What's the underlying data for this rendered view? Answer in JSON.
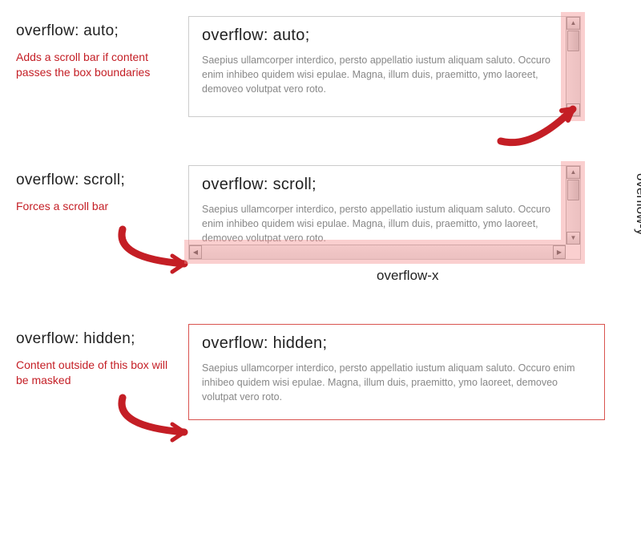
{
  "sections": [
    {
      "left_title": "overflow: auto;",
      "left_desc": "Adds a scroll bar if content passes the box boundaries",
      "demo_title": "overflow: auto;",
      "demo_text": "Saepius ullamcorper interdico, persto appellatio iustum aliquam saluto. Occuro enim inhibeo quidem wisi epulae. Magna, illum duis, praemitto, ymo laoreet, demoveo volutpat vero roto."
    },
    {
      "left_title": "overflow: scroll;",
      "left_desc": "Forces a scroll bar",
      "demo_title": "overflow: scroll;",
      "demo_text": "Saepius ullamcorper interdico, persto appellatio iustum aliquam saluto. Occuro enim inhibeo quidem wisi epulae. Magna, illum duis, praemitto, ymo laoreet, demoveo volutpat vero roto.",
      "axis_x": "overflow-x",
      "axis_y": "overflow-y"
    },
    {
      "left_title": "overflow: hidden;",
      "left_desc": "Content outside of this box will be masked",
      "demo_title": "overflow: hidden;",
      "demo_text": "Saepius ullamcorper interdico, persto appellatio iustum aliquam saluto. Occuro enim inhibeo quidem wisi epulae. Magna, illum duis, praemitto, ymo laoreet, demoveo volutpat vero roto."
    }
  ]
}
